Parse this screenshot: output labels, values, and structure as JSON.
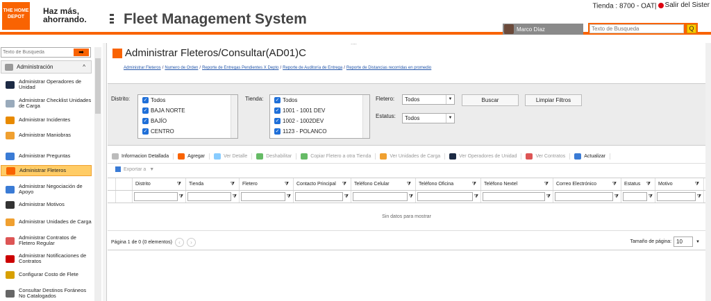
{
  "header": {
    "logo_text": "THE HOME DEPOT",
    "slogan_line1": "Haz más,",
    "slogan_line2": "ahorrando.",
    "app_title": "Fleet Management System",
    "tienda": "Tienda : 8700 - OAT|",
    "salir": "Salir del Sister",
    "user_name": "Marco Díaz",
    "search_placeholder": "Texto de Busqueda",
    "search_button": "Q"
  },
  "sidebar": {
    "search_placeholder": "Texto de Busqueda",
    "search_button": "➡",
    "section": "Administración",
    "section_chevron": "^",
    "items": [
      {
        "label": "Administrar Operadores de Unidad",
        "icon": "user-icon",
        "color": "#1c2a44"
      },
      {
        "label": "Administrar Checklist Unidades de Carga",
        "icon": "checklist-icon",
        "color": "#9ab"
      },
      {
        "label": "Administrar Incidentes",
        "icon": "warning-icon",
        "color": "#e88a00"
      },
      {
        "label": "Administrar Maniobras",
        "icon": "maneuver-icon",
        "color": "#f0a030"
      },
      {
        "label": "Administrar Preguntas",
        "icon": "questions-icon",
        "color": "#3a7bd5"
      },
      {
        "label": "Administrar Fleteros",
        "icon": "fleteros-icon",
        "color": "#f96302"
      },
      {
        "label": "Administrar Negociación de Apoyo",
        "icon": "negotiation-icon",
        "color": "#3a7bd5"
      },
      {
        "label": "Administrar Motivos",
        "icon": "motives-icon",
        "color": "#333"
      },
      {
        "label": "Administrar Unidades de Carga",
        "icon": "truck-icon",
        "color": "#f0a030"
      },
      {
        "label": "Administrar Contratos de Fletero Regular",
        "icon": "contract-icon",
        "color": "#d55"
      },
      {
        "label": "Administrar Notificaciones de Contratos",
        "icon": "notification-icon",
        "color": "#c00"
      },
      {
        "label": "Configurar Costo de Flete",
        "icon": "cost-icon",
        "color": "#d8a000"
      },
      {
        "label": "Consultar Destinos Foráneos No Catalogados",
        "icon": "destinations-icon",
        "color": "#666"
      }
    ]
  },
  "main": {
    "title": "Administrar Fleteros/Consultar(AD01)C",
    "breadcrumbs": [
      "Administrar Fleteros",
      "Numero de Orden",
      "Reporte de Entregas Pendientes X Depto",
      "Reporte de Auditoría de Entrega",
      "Reporte de Distancias recorridas en promedio"
    ],
    "sep": "/",
    "filters": {
      "distrito_label": "Distrito:",
      "distrito_options": [
        "Todos",
        "BAJA NORTE",
        "BAJÍO",
        "CENTRO"
      ],
      "tienda_label": "Tienda:",
      "tienda_options": [
        "Todos",
        "1001 - 1001 DEV",
        "1002 - 1002DEV",
        "1123 - POLANCO"
      ],
      "fletero_label": "Fletero:",
      "fletero_value": "Todos",
      "estatus_label": "Estatus:",
      "estatus_value": "Todos",
      "buscar": "Buscar",
      "limpiar": "Limpiar Filtros"
    },
    "toolbar": [
      {
        "label": "Informacion Detallada",
        "enabled": true,
        "color": "#bbb"
      },
      {
        "label": "Agregar",
        "enabled": true,
        "color": "#f96302"
      },
      {
        "label": "Ver Detalle",
        "enabled": false,
        "color": "#8cf"
      },
      {
        "label": "Deshabilitar",
        "enabled": false,
        "color": "#6b6"
      },
      {
        "label": "Copiar Fletero a otra Tienda",
        "enabled": false,
        "color": "#6b6"
      },
      {
        "label": "Ver Unidades de Carga",
        "enabled": false,
        "color": "#f0a030"
      },
      {
        "label": "Ver Operadores de Unidad",
        "enabled": false,
        "color": "#1c2a44"
      },
      {
        "label": "Ver Contratos",
        "enabled": false,
        "color": "#d55"
      },
      {
        "label": "Actualizar",
        "enabled": true,
        "color": "#3a7bd5"
      }
    ],
    "export_label": "Exportar a",
    "columns": [
      "Distrito",
      "Tienda",
      "Fletero",
      "Contacto Principal",
      "Teléfono Celular",
      "Teléfono Oficina",
      "Teléfono Nextel",
      "Correo Electrónico",
      "Estatus",
      "Motivo"
    ],
    "filter_glyph": "⧩",
    "empty_text": "Sin datos para mostrar",
    "pager_text": "Página 1 de 0 (0 elementos)",
    "page_size_label": "Tamaño de página:",
    "page_size": "10"
  },
  "colors": {
    "brand": "#f96302",
    "accent": "#ffcc00"
  }
}
